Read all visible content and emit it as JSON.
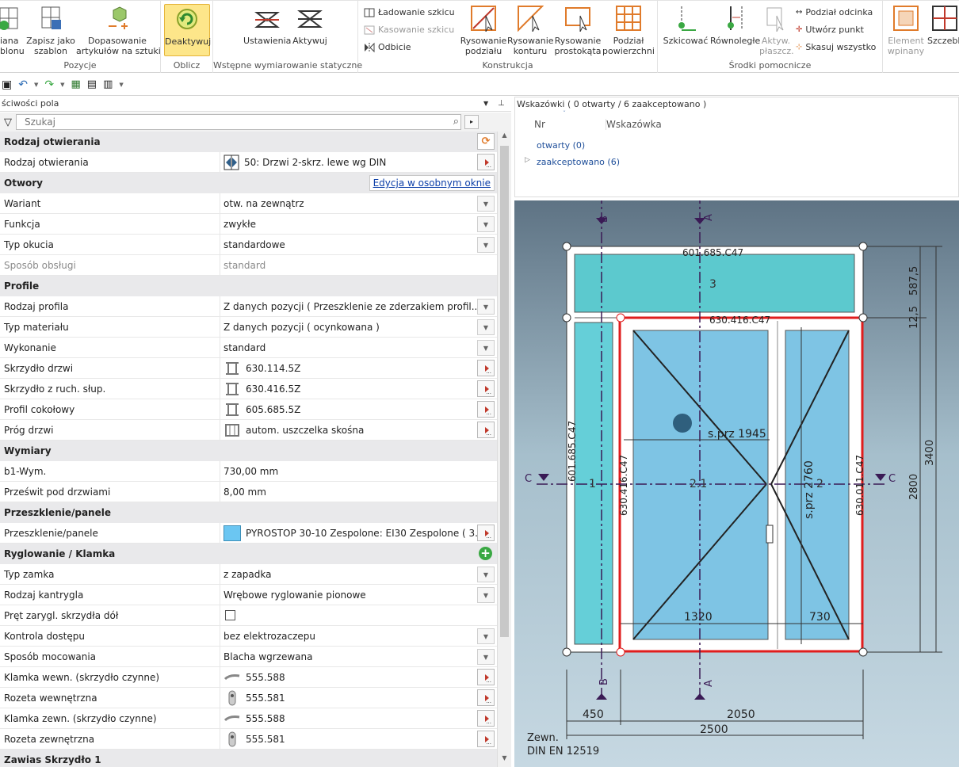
{
  "ribbon": {
    "groups": [
      {
        "label": "Pozycje",
        "buttons": [
          "iana\nblonu",
          "Zapisz jako\nszablon",
          "Dopasowanie\nartykułów na sztuki"
        ]
      },
      {
        "label": "Oblicz",
        "buttons": [
          "Deaktywuj"
        ]
      },
      {
        "label": "Wstępne wymiarowanie statyczne",
        "buttons": [
          "Ustawienia",
          "Aktywuj"
        ]
      },
      {
        "label": "Konstrukcja",
        "small": [
          "Ładowanie szkicu",
          "Kasowanie szkicu",
          "Odbicie"
        ],
        "buttons": [
          "Rysowanie\npodziału",
          "Rysowanie\nkonturu",
          "Rysowanie\nprostokąta",
          "Podział\npowierzchni"
        ]
      },
      {
        "label": "Środki pomocnicze",
        "buttons": [
          "Szkicować",
          "Równoległe",
          "Aktyw.\npłaszcz."
        ],
        "small": [
          "Podział odcinka",
          "Utwórz punkt",
          "Skasuj wszystko"
        ]
      },
      {
        "label": "",
        "buttons": [
          "Element\nwpinany",
          "Szczebli"
        ]
      }
    ]
  },
  "panel": {
    "title": "ściwości pola",
    "search_placeholder": "Szukaj"
  },
  "props": [
    {
      "type": "sec",
      "label": "Rodzaj otwierania"
    },
    {
      "type": "item",
      "label": "Rodzaj otwierania",
      "value": "50: Drzwi 2-skrz. lewe wg DIN",
      "ctrl": "btn",
      "icon": "door-icon"
    },
    {
      "type": "sec",
      "label": "Otwory",
      "link": "Edycja w osobnym oknie"
    },
    {
      "type": "item",
      "label": "Wariant",
      "value": "otw. na zewnątrz",
      "ctrl": "dd"
    },
    {
      "type": "item",
      "label": "Funkcja",
      "value": "zwykłe",
      "ctrl": "dd"
    },
    {
      "type": "item",
      "label": "Typ okucia",
      "value": "standardowe",
      "ctrl": "dd"
    },
    {
      "type": "item",
      "label": "Sposób obsługi",
      "value": "standard",
      "gray": true
    },
    {
      "type": "sec",
      "label": "Profile"
    },
    {
      "type": "item",
      "label": "Rodzaj profila",
      "value": "Z danych pozycji ( Przeszklenie ze zderzakiem profil...",
      "ctrl": "dd"
    },
    {
      "type": "item",
      "label": "Typ materiału",
      "value": "Z danych pozycji ( ocynkowana )",
      "ctrl": "dd"
    },
    {
      "type": "item",
      "label": "Wykonanie",
      "value": "standard",
      "ctrl": "dd"
    },
    {
      "type": "item",
      "label": "Skrzydło drzwi",
      "value": "630.114.5Z",
      "ctrl": "btn",
      "icon": "profile-icon"
    },
    {
      "type": "item",
      "label": "Skrzydło z ruch. słup.",
      "value": "630.416.5Z",
      "ctrl": "btn",
      "icon": "profile-icon"
    },
    {
      "type": "item",
      "label": "Profil cokołowy",
      "value": "605.685.5Z",
      "ctrl": "btn",
      "icon": "profile-icon"
    },
    {
      "type": "item",
      "label": "Próg drzwi",
      "value": "autom. uszczelka skośna",
      "ctrl": "btn",
      "icon": "threshold-icon"
    },
    {
      "type": "sec",
      "label": "Wymiary"
    },
    {
      "type": "item",
      "label": "b1-Wym.",
      "value": "730,00 mm"
    },
    {
      "type": "item",
      "label": "Prześwit pod drzwiami",
      "value": "8,00 mm"
    },
    {
      "type": "sec",
      "label": "Przeszklenie/panele"
    },
    {
      "type": "item",
      "label": "Przeszklenie/panele",
      "value": "PYROSTOP 30-10 Zespolone: EI30 Zespolone ( 3...",
      "ctrl": "btn",
      "icon": "glass-swatch"
    },
    {
      "type": "sec",
      "label": "Ryglowanie / Klamka",
      "add": true
    },
    {
      "type": "item",
      "label": "Typ zamka",
      "value": "z zapadka",
      "ctrl": "dd"
    },
    {
      "type": "item",
      "label": "Rodzaj kantrygla",
      "value": "Wrębowe ryglowanie pionowe",
      "ctrl": "dd"
    },
    {
      "type": "item",
      "label": "Pręt zarygl. skrzydła dół",
      "value": "",
      "checkbox": true
    },
    {
      "type": "item",
      "label": "Kontrola dostępu",
      "value": "bez elektrozaczepu",
      "ctrl": "dd"
    },
    {
      "type": "item",
      "label": "Sposób mocowania",
      "value": "Blacha wgrzewana",
      "ctrl": "dd"
    },
    {
      "type": "item",
      "label": "Klamka wewn. (skrzydło czynne)",
      "value": "555.588",
      "ctrl": "btn",
      "icon": "handle-icon"
    },
    {
      "type": "item",
      "label": "Rozeta wewnętrzna",
      "value": "555.581",
      "ctrl": "btn",
      "icon": "rosette-icon"
    },
    {
      "type": "item",
      "label": "Klamka zewn. (skrzydło czynne)",
      "value": "555.588",
      "ctrl": "btn",
      "icon": "handle-icon"
    },
    {
      "type": "item",
      "label": "Rozeta zewnętrzna",
      "value": "555.581",
      "ctrl": "btn",
      "icon": "rosette-icon"
    },
    {
      "type": "sec",
      "label": "Zawias Skrzydło 1"
    }
  ],
  "hints": {
    "title": "Wskazówki ( 0 otwarty / 6 zaakceptowano )",
    "col_nr": "Nr",
    "col_hint": "Wskazówka",
    "open": "otwarty (0)",
    "accepted": "zaakceptowano (6)"
  },
  "drawing": {
    "top_profile": "601.685.C47",
    "mid_profile": "630.416.C47",
    "left_profile": "601.685.C47",
    "left_inner": "630.416.C47",
    "right_profile": "630.011.C47",
    "field3": "3",
    "field1": "1",
    "field21": "2.1",
    "field2": "2",
    "spr1945": "s.prz 1945",
    "spr2760": "s.prz 2760",
    "dim1320": "1320",
    "dim730": "730",
    "dim450": "450",
    "dim2050": "2050",
    "dim2500": "2500",
    "dim125": "12,5",
    "dim5875": "587,5",
    "dim3400": "3400",
    "dim2800": "2800",
    "secA": "A",
    "secB": "B",
    "secC": "C",
    "footer1": "Zewn.",
    "footer2": "DIN EN 12519"
  }
}
